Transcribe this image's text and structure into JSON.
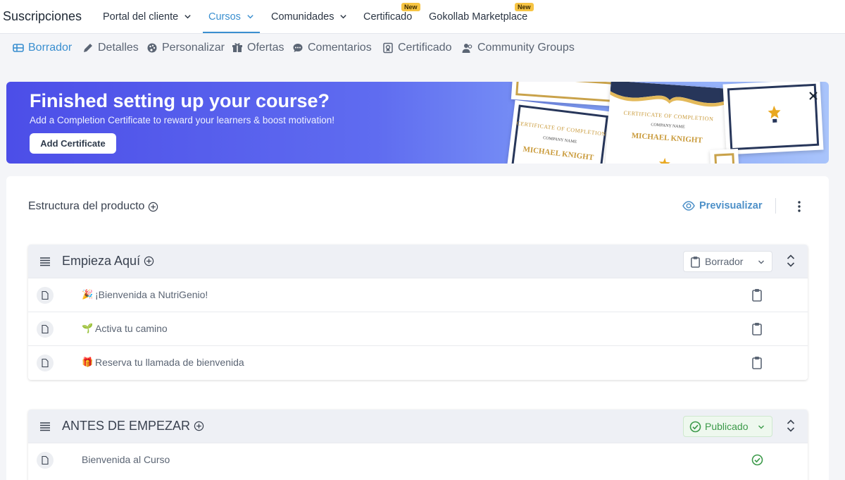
{
  "nav": {
    "brand": "Suscripciones",
    "items": [
      {
        "label": "Portal del cliente"
      },
      {
        "label": "Cursos"
      },
      {
        "label": "Comunidades"
      },
      {
        "label": "Certificado"
      },
      {
        "label": "Gokollab Marketplace"
      }
    ],
    "new_badge": "New"
  },
  "subtabs": [
    {
      "label": "Borrador",
      "icon": "table-icon"
    },
    {
      "label": "Detalles",
      "icon": "pencil-icon"
    },
    {
      "label": "Personalizar",
      "icon": "palette-icon"
    },
    {
      "label": "Ofertas",
      "icon": "gift-icon"
    },
    {
      "label": "Comentarios",
      "icon": "chat-icon"
    },
    {
      "label": "Certificado",
      "icon": "certificate-icon"
    },
    {
      "label": "Community Groups",
      "icon": "users-icon"
    }
  ],
  "banner": {
    "title": "Finished setting up your course?",
    "subtitle": "Add a Completion Certificate to reward your learners & boost motivation!",
    "button": "Add Certificate",
    "cert_text": {
      "heading": "CERTIFICATE OF COMPLETION",
      "company": "COMPANY NAME",
      "name": "MICHAEL KNIGHT"
    }
  },
  "structure": {
    "title": "Estructura del producto",
    "preview": "Previsualizar",
    "sections": [
      {
        "title": "Empieza Aquí",
        "status": "Borrador",
        "lessons": [
          {
            "emoji": "🎉",
            "title": "¡Bienvenida a NutriGenio!",
            "status": "draft"
          },
          {
            "emoji": "🌱",
            "title": "Activa tu camino",
            "status": "draft"
          },
          {
            "emoji": "🎁",
            "title": "Reserva tu llamada de bienvenida",
            "status": "draft"
          }
        ]
      },
      {
        "title": "ANTES DE EMPEZAR",
        "status": "Publicado",
        "lessons": [
          {
            "emoji": "",
            "title": "Bienvenida al Curso",
            "status": "published"
          }
        ]
      }
    ]
  },
  "colors": {
    "accent": "#3a8fd0",
    "badge": "#f6c443",
    "published": "#3c9a4a",
    "banner_start": "#4c4ee8",
    "banner_end": "#a9c4fb"
  }
}
